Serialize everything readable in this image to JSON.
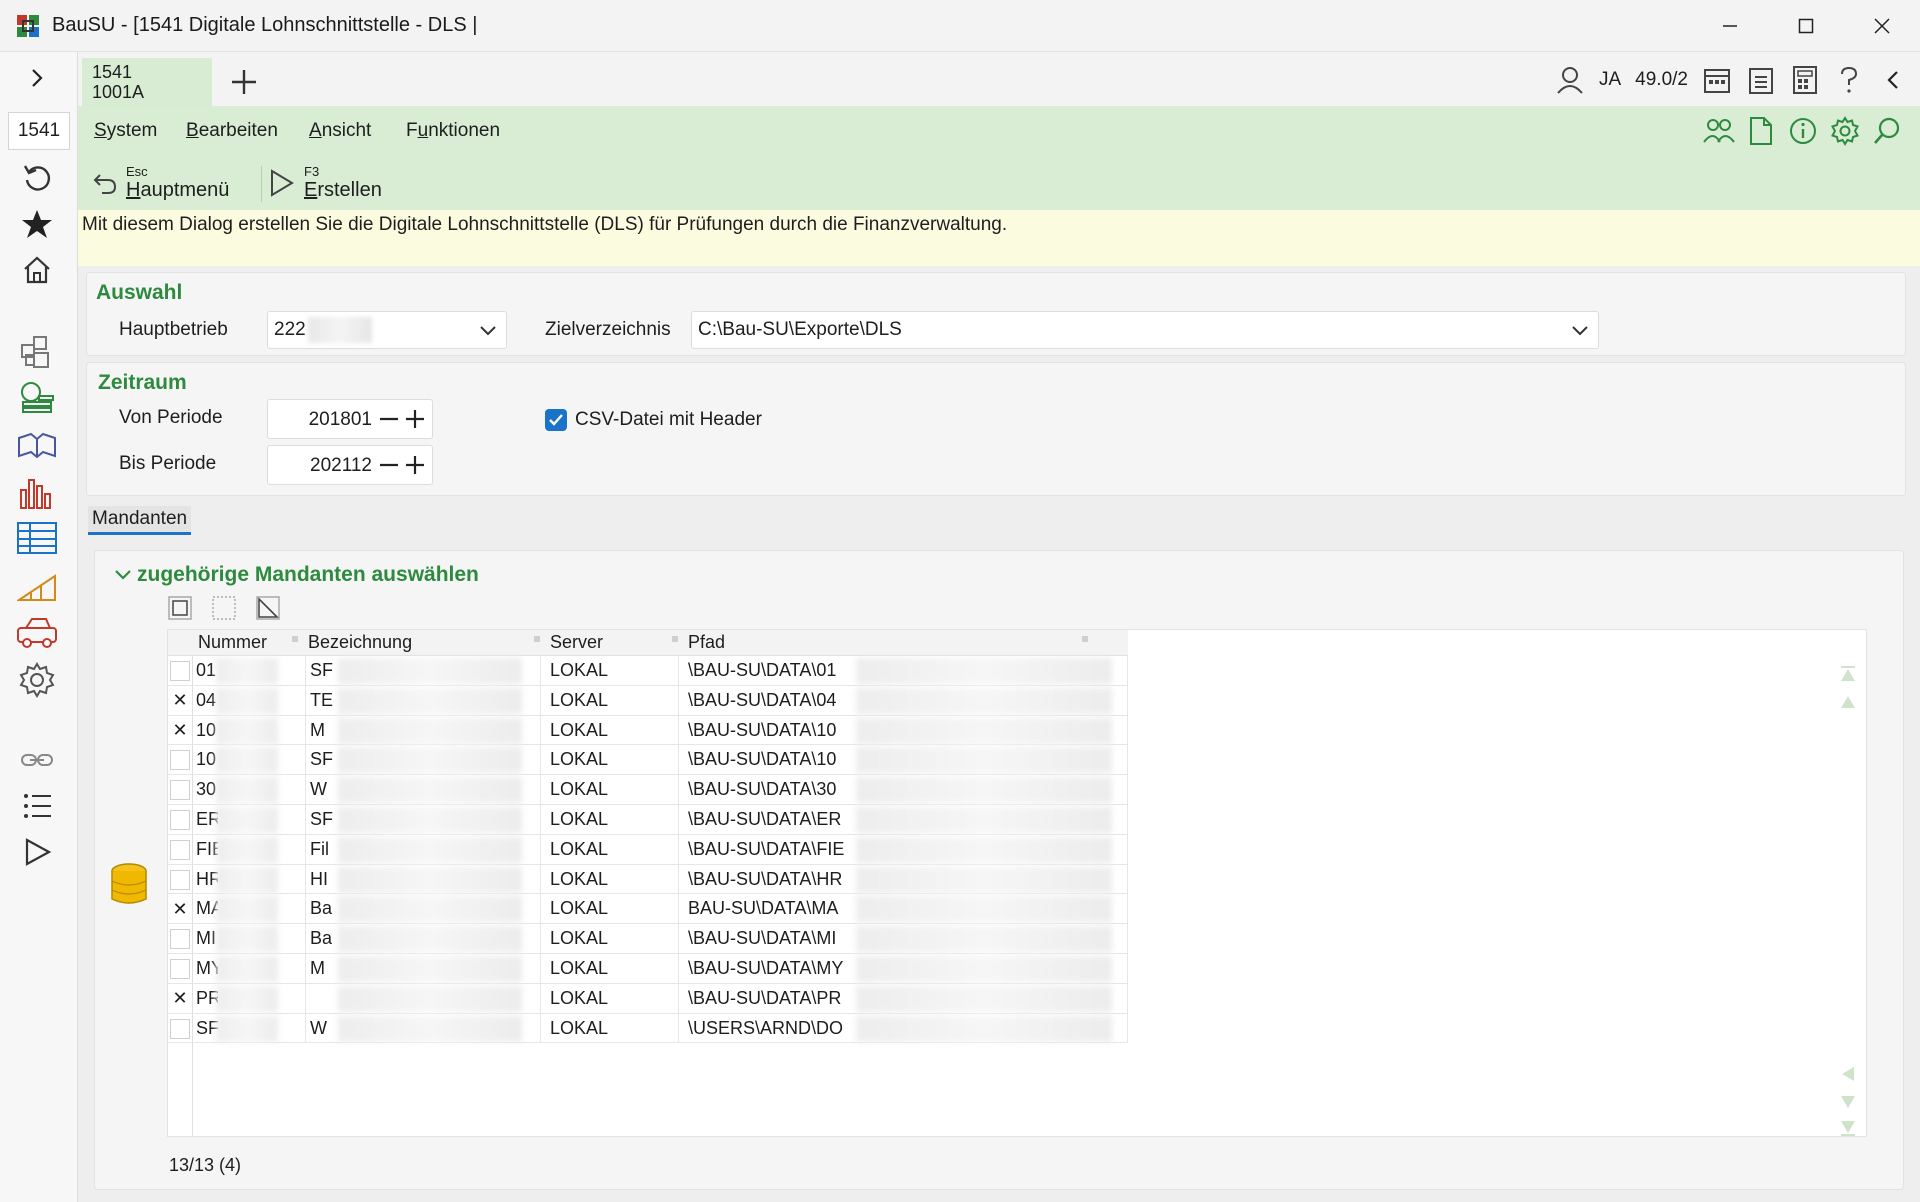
{
  "window": {
    "title": "BauSU - [1541 Digitale Lohnschnittstelle - DLS |"
  },
  "sidebar": {
    "code": "1541"
  },
  "tab": {
    "line1": "1541",
    "line2": "1001A"
  },
  "topbar": {
    "user": "JA",
    "version": "49.0/2"
  },
  "menu": {
    "items": [
      {
        "pre": "",
        "ul": "S",
        "post": "ystem"
      },
      {
        "pre": "",
        "ul": "B",
        "post": "earbeiten"
      },
      {
        "pre": "",
        "ul": "A",
        "post": "nsicht"
      },
      {
        "pre": "F",
        "ul": "u",
        "post": "nktionen"
      }
    ]
  },
  "toolbar": {
    "main_menu": {
      "key": "Esc",
      "pre": "",
      "ul": "H",
      "post": "auptmenü"
    },
    "create": {
      "key": "F3",
      "pre": "",
      "ul": "E",
      "post": "rstellen"
    }
  },
  "info_text": "Mit diesem Dialog erstellen Sie die Digitale Lohnschnittstelle (DLS) für Prüfungen durch die Finanzverwaltung.",
  "auswahl": {
    "title": "Auswahl",
    "hauptbetrieb_label": "Hauptbetrieb",
    "hauptbetrieb_value": "222",
    "zielverzeichnis_label": "Zielverzeichnis",
    "zielverzeichnis_value": "C:\\Bau-SU\\Exporte\\DLS"
  },
  "zeitraum": {
    "title": "Zeitraum",
    "von_label": "Von Periode",
    "von_value": "201801",
    "bis_label": "Bis Periode",
    "bis_value": "202112",
    "csv_label": "CSV-Datei mit Header",
    "csv_checked": true
  },
  "tabs": {
    "mandanten": "Mandanten"
  },
  "mandanten": {
    "title": "zugehörige Mandanten auswählen",
    "columns": [
      "Nummer",
      "Bezeichnung",
      "Server",
      "Pfad"
    ],
    "rows": [
      {
        "checked": false,
        "nummer": "01",
        "bez": "SF",
        "server": "LOKAL",
        "pfad": "\\BAU-SU\\DATA\\01"
      },
      {
        "checked": true,
        "nummer": "04",
        "bez": "TE",
        "server": "LOKAL",
        "pfad": "\\BAU-SU\\DATA\\04"
      },
      {
        "checked": true,
        "nummer": "10",
        "bez": "M",
        "server": "LOKAL",
        "pfad": "\\BAU-SU\\DATA\\10"
      },
      {
        "checked": false,
        "nummer": "10",
        "bez": "SF",
        "server": "LOKAL",
        "pfad": "\\BAU-SU\\DATA\\10"
      },
      {
        "checked": false,
        "nummer": "30",
        "bez": "W",
        "server": "LOKAL",
        "pfad": "\\BAU-SU\\DATA\\30"
      },
      {
        "checked": false,
        "nummer": "ER",
        "bez": "SF",
        "server": "LOKAL",
        "pfad": "\\BAU-SU\\DATA\\ER"
      },
      {
        "checked": false,
        "nummer": "FIE",
        "bez": "Fil",
        "server": "LOKAL",
        "pfad": "\\BAU-SU\\DATA\\FIE"
      },
      {
        "checked": false,
        "nummer": "HR",
        "bez": "HI",
        "server": "LOKAL",
        "pfad": "\\BAU-SU\\DATA\\HR"
      },
      {
        "checked": true,
        "nummer": "MA",
        "bez": "Ba",
        "server": "LOKAL",
        "pfad": "BAU-SU\\DATA\\MA"
      },
      {
        "checked": false,
        "nummer": "MI",
        "bez": "Ba",
        "server": "LOKAL",
        "pfad": "\\BAU-SU\\DATA\\MI"
      },
      {
        "checked": false,
        "nummer": "MY",
        "bez": "M",
        "server": "LOKAL",
        "pfad": "\\BAU-SU\\DATA\\MY"
      },
      {
        "checked": true,
        "nummer": "PR",
        "bez": "",
        "server": "LOKAL",
        "pfad": "\\BAU-SU\\DATA\\PR"
      },
      {
        "checked": false,
        "nummer": "SF",
        "bez": "W",
        "server": "LOKAL",
        "pfad": "\\USERS\\ARND\\DO"
      }
    ],
    "count": "13/13 (4)"
  },
  "colors": {
    "accent_green": "#2d8a3e",
    "menu_bg": "#d9edd5",
    "info_bg": "#fbfbe0",
    "checkbox_blue": "#1a73c8"
  }
}
